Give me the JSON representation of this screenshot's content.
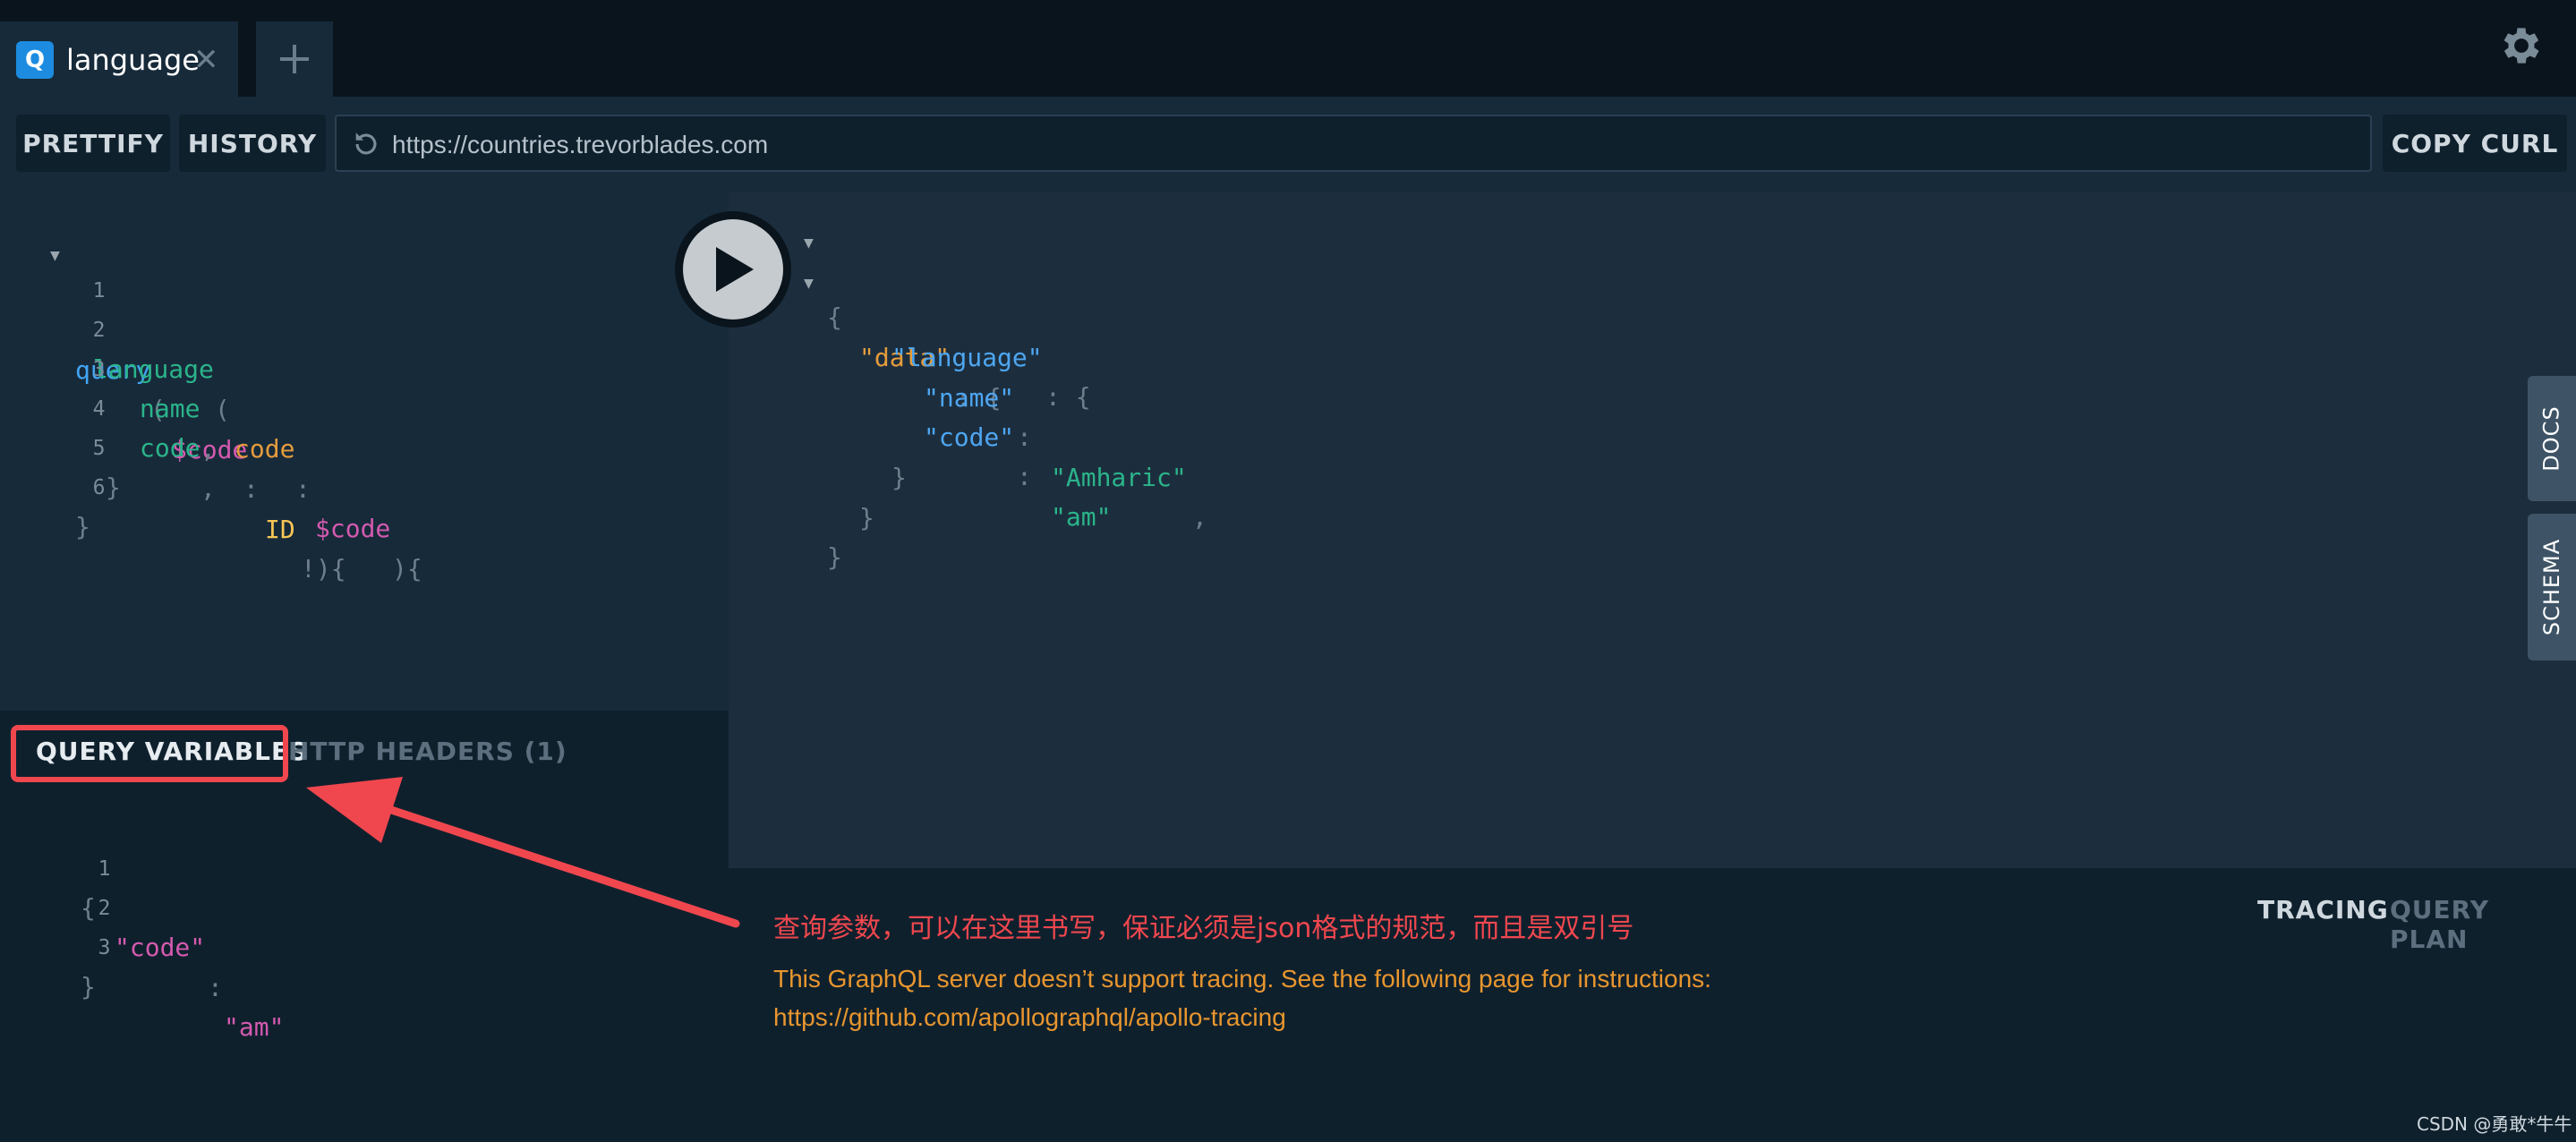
{
  "tab": {
    "badge": "Q",
    "title": "language",
    "close": "✕"
  },
  "toolbar": {
    "prettify": "PRETTIFY",
    "history": "HISTORY",
    "url": "https://countries.trevorblades.com",
    "copy_curl": "COPY CURL"
  },
  "editor": {
    "line_numbers": [
      "1",
      "2",
      "3",
      "4",
      "5",
      "6"
    ],
    "tokens": {
      "query": "query",
      "paren_open": "(",
      "var_code": "$code",
      "colon": ":",
      "type_id": "ID",
      "bang_paren": "!){",
      "language": "language",
      "arg_code": "code",
      "colon2": ":",
      "var_code2": "$code",
      "paren_brace": "){",
      "name": "name",
      "comma1": ",",
      "code": "code",
      "comma2": ",",
      "close_inner": "}",
      "close_outer": "}"
    }
  },
  "result": {
    "open": "{",
    "data_key": "\"data\"",
    "colon_open1": ": {",
    "language_key": "\"language\"",
    "colon_open2": ": {",
    "name_key": "\"name\"",
    "colon_a": ": ",
    "name_val": "\"Amharic\"",
    "comma": ",",
    "code_key": "\"code\"",
    "colon_b": ": ",
    "code_val": "\"am\"",
    "close1": "}",
    "close2": "}",
    "close3": "}"
  },
  "variables": {
    "tab_active": "QUERY VARIABLES",
    "tab_headers": "HTTP HEADERS (1)",
    "line_numbers": [
      "1",
      "2",
      "3"
    ],
    "open": "{",
    "key": "\"code\"",
    "colon": ":",
    "value": "\"am\"",
    "close": "}"
  },
  "tracing": {
    "tab_tracing": "TRACING",
    "tab_query_plan": "QUERY PLAN",
    "note_cn": "查询参数，可以在这里书写，保证必须是json格式的规范，而且是双引号",
    "message_line1": "This GraphQL server doesn’t support tracing. See the following page for instructions:",
    "message_line2": "https://github.com/apollographql/apollo-tracing"
  },
  "side_tabs": {
    "docs": "DOCS",
    "schema": "SCHEMA"
  },
  "watermark": "CSDN @勇敢*牛牛",
  "colors": {
    "accent_red": "#f0474e",
    "trace_orange": "#e8962e",
    "keyword_blue": "#42a5f5",
    "string_green": "#2bb48a"
  }
}
